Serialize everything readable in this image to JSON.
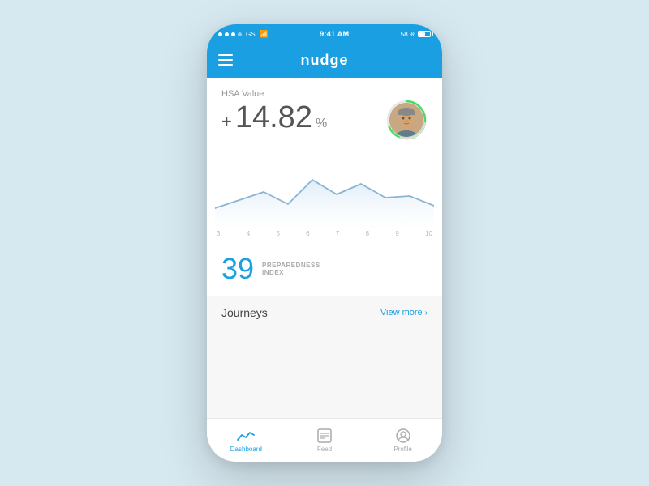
{
  "statusBar": {
    "carrier": "GS",
    "time": "9:41 AM",
    "battery": "58 %"
  },
  "header": {
    "logo": "nudge",
    "menuIcon": "hamburger"
  },
  "hsa": {
    "label": "HSA Value",
    "prefix": "+",
    "value": "14.82",
    "unit": "%"
  },
  "chart": {
    "xLabels": [
      "3",
      "4",
      "5",
      "6",
      "7",
      "8",
      "9",
      "10"
    ]
  },
  "preparedness": {
    "number": "39",
    "label_line1": "PREPAREDNESS",
    "label_line2": "INDEX"
  },
  "journeys": {
    "title": "Journeys",
    "viewMore": "View more"
  },
  "bottomNav": {
    "items": [
      {
        "id": "dashboard",
        "label": "Dashboard",
        "active": true
      },
      {
        "id": "feed",
        "label": "Feed",
        "active": false
      },
      {
        "id": "profile",
        "label": "Profile",
        "active": false
      }
    ]
  }
}
